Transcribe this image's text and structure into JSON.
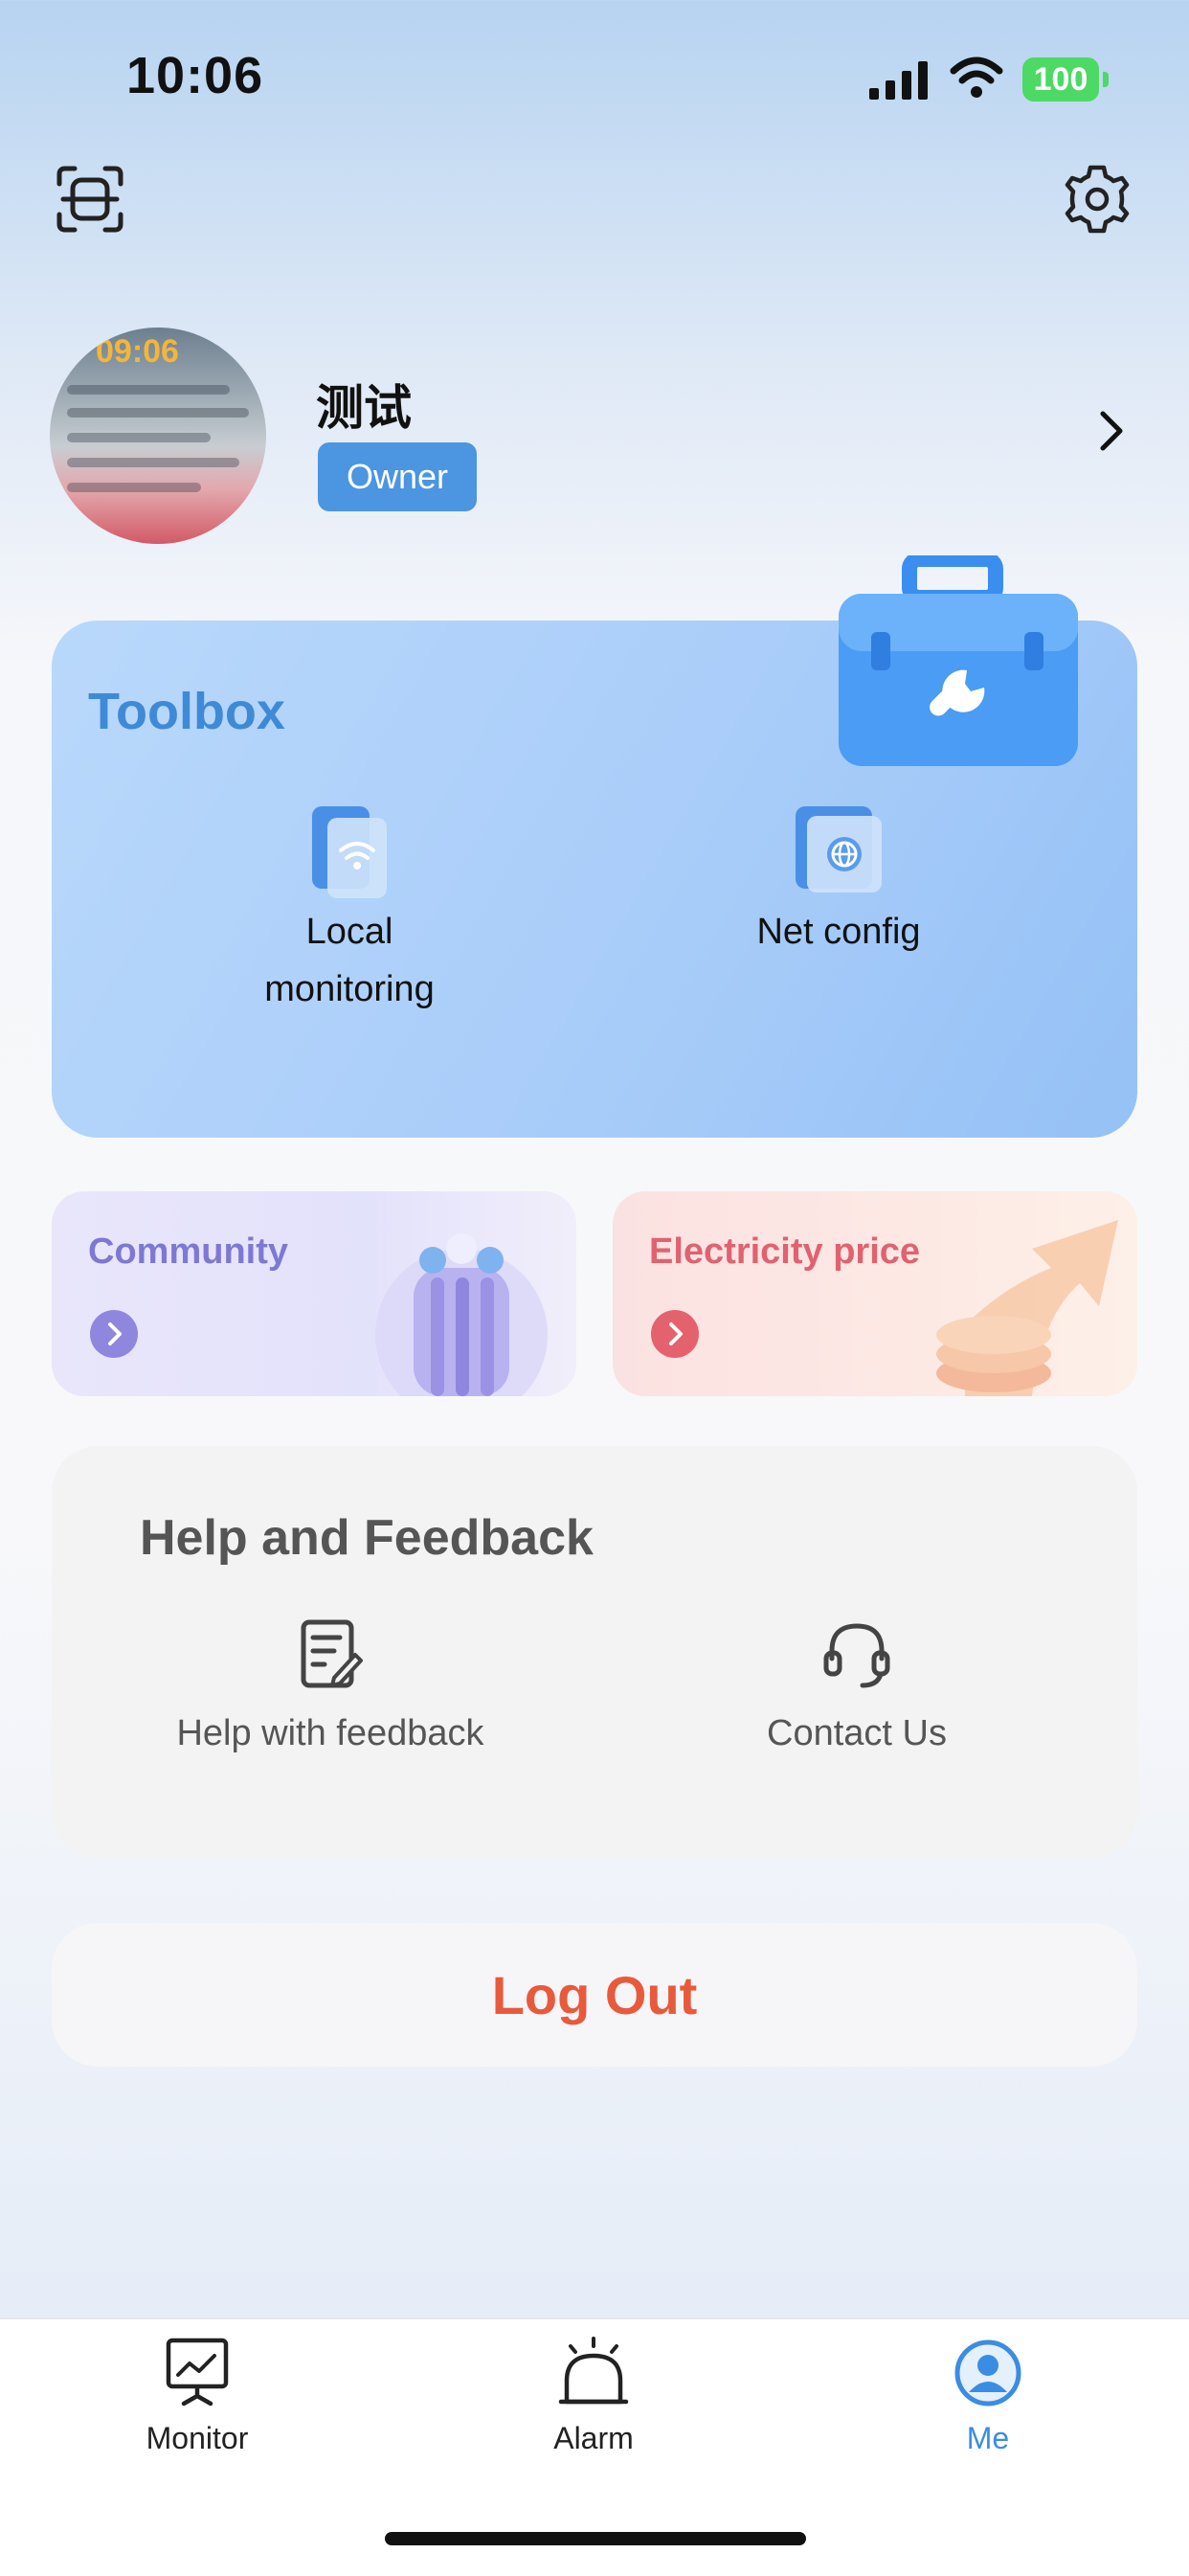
{
  "status_bar": {
    "time": "10:06",
    "battery": "100"
  },
  "header": {
    "scan_icon": "scan-icon",
    "settings_icon": "gear-icon"
  },
  "profile": {
    "avatar_time": "09:06",
    "name": "测试",
    "role": "Owner"
  },
  "toolbox": {
    "title": "Toolbox",
    "items": [
      {
        "label_line1": "Local",
        "label_line2": "monitoring",
        "icon": "local-monitoring-icon"
      },
      {
        "label_line1": "Net config",
        "icon": "net-config-icon"
      }
    ]
  },
  "cards": {
    "community": {
      "title": "Community"
    },
    "electricity": {
      "title": "Electricity price"
    }
  },
  "help": {
    "title": "Help and Feedback",
    "items": [
      {
        "label": "Help with feedback",
        "icon": "feedback-edit-icon"
      },
      {
        "label": "Contact Us",
        "icon": "headset-icon"
      }
    ]
  },
  "logout": {
    "label": "Log Out"
  },
  "tabbar": {
    "tabs": [
      {
        "label": "Monitor",
        "icon": "monitor-icon"
      },
      {
        "label": "Alarm",
        "icon": "alarm-bell-icon"
      },
      {
        "label": "Me",
        "icon": "user-profile-icon",
        "active": true
      }
    ]
  },
  "colors": {
    "accent": "#3a8de2",
    "logout": "#e85a3c",
    "community": "#7e78d4",
    "electricity": "#e06270",
    "toolbox_title": "#3f8ad6"
  }
}
